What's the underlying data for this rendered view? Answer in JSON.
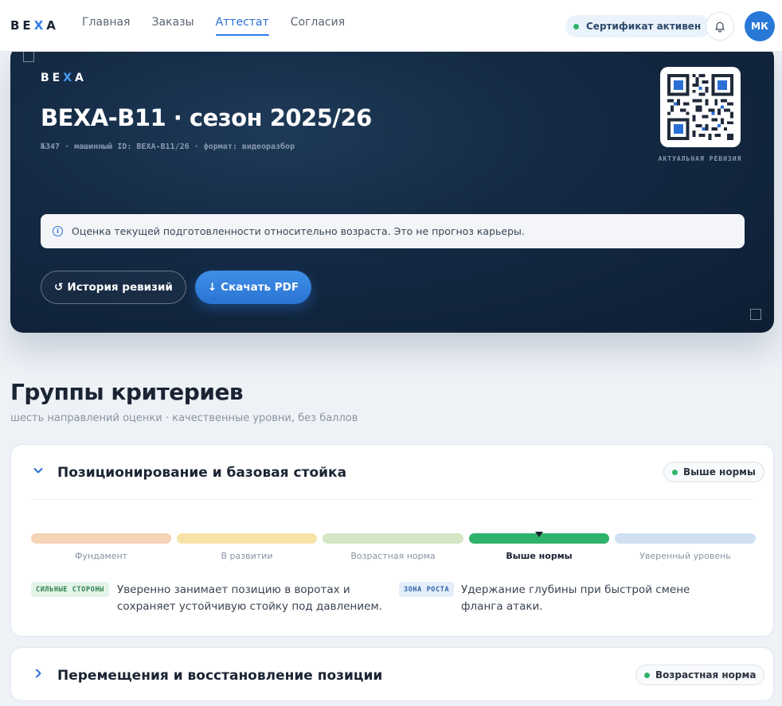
{
  "header": {
    "brand": {
      "part1": "BE",
      "accent": "X",
      "part2": "A"
    },
    "nav": [
      {
        "label": "Главная",
        "active": false
      },
      {
        "label": "Заказы",
        "active": false
      },
      {
        "label": "Аттестат",
        "active": true
      },
      {
        "label": "Согласия",
        "active": false
      }
    ],
    "certificate_status": "Сертификат активен",
    "avatar_initials": "МК"
  },
  "hero": {
    "brand": {
      "part1": "BE",
      "accent": "X",
      "part2": "A"
    },
    "title": "BEXA-B11 · сезон 2025/26",
    "meta": "№347 · машинный ID: BEXA-B11/26 · формат: видеоразбор",
    "qr_caption": "АКТУАЛЬНАЯ РЕВИЗИЯ",
    "info_text": "Оценка текущей подготовленности относительно возраста. Это не прогноз карьеры.",
    "buttons": {
      "history_label": "История ревизий",
      "history_glyph": "↺",
      "pdf_label": "Скачать PDF",
      "pdf_glyph": "↓"
    }
  },
  "section": {
    "title": "Группы критериев",
    "subtitle": "шесть направлений оценки · качественные уровни, без баллов"
  },
  "scale_levels": [
    {
      "label": "Фундамент",
      "color": "#f5d3b5"
    },
    {
      "label": "В развитии",
      "color": "#f7e3a8"
    },
    {
      "label": "Возрастная норма",
      "color": "#d4e6c4"
    },
    {
      "label": "Выше нормы",
      "color": "#2fb36a"
    },
    {
      "label": "Уверенный уровень",
      "color": "#cfe0f2"
    }
  ],
  "criteria": [
    {
      "title": "Позиционирование и базовая стойка",
      "level": "Выше нормы",
      "level_index": 3,
      "expanded": true,
      "strengths_tag": "СИЛЬНЫЕ СТОРОНЫ",
      "strengths_text": "Уверенно занимает позицию в воротах и сохраняет устойчивую стойку под давлением.",
      "growth_tag": "ЗОНА РОСТА",
      "growth_text": "Удержание глубины при быстрой смене фланга атаки."
    },
    {
      "title": "Перемещения и восстановление позиции",
      "level": "Возрастная норма",
      "expanded": false
    }
  ]
}
